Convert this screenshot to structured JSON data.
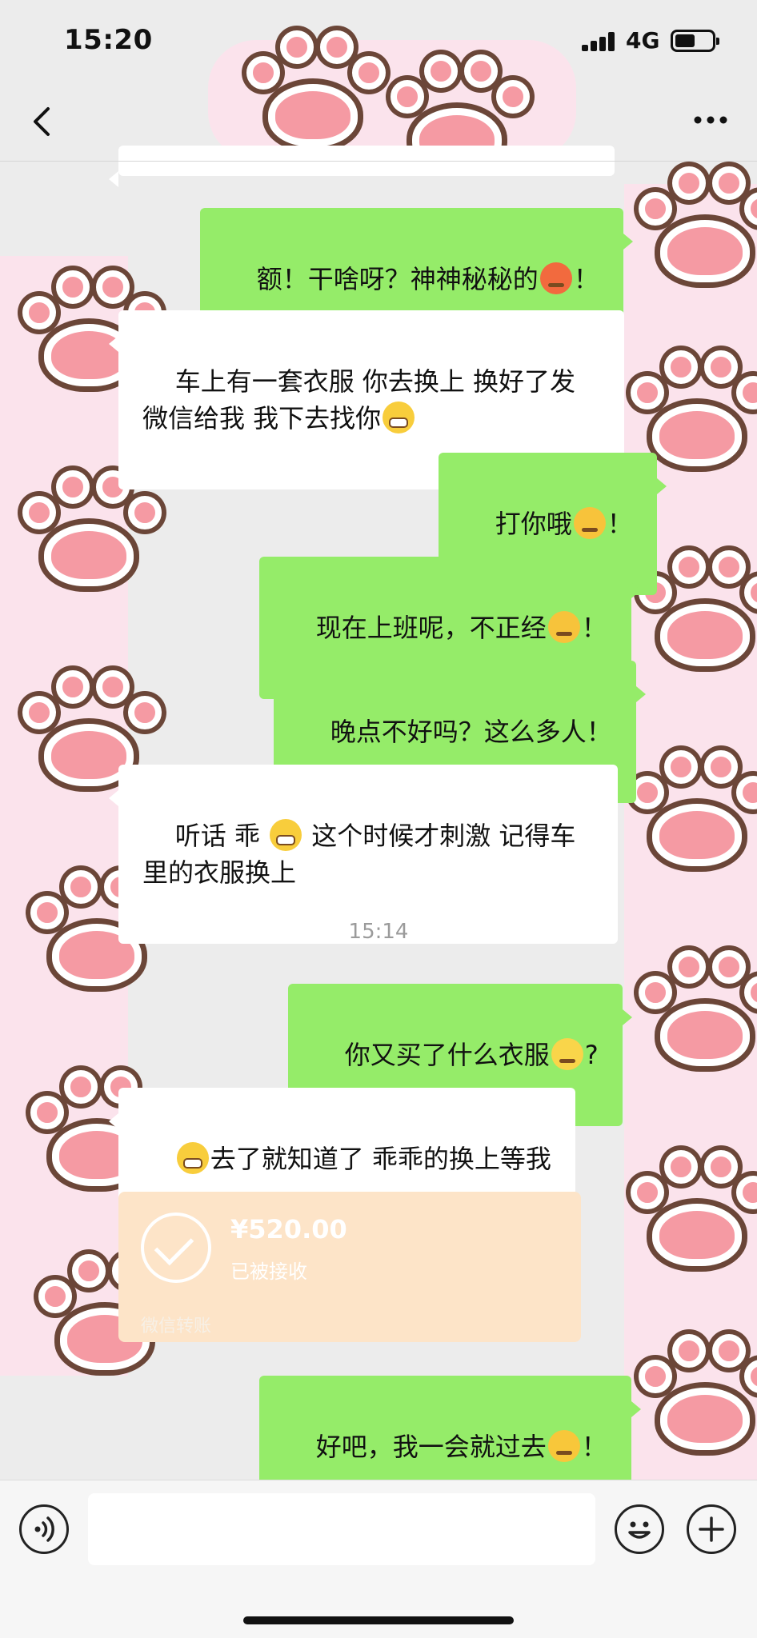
{
  "status_bar": {
    "time": "15:20",
    "network": "4G",
    "battery_level": 0.55
  },
  "nav": {
    "back_icon": "chevron-left-icon",
    "more_icon": "more-dots-icon"
  },
  "messages": [
    {
      "dir": "out",
      "before": "额！干啥呀？神神秘秘的",
      "emoji": "angry-face-icon",
      "after": "！"
    },
    {
      "dir": "in",
      "before": "车上有一套衣服 你去换上 换好了发微信给我 我下去找你",
      "emoji": "grin-face-icon",
      "after": ""
    },
    {
      "dir": "out",
      "before": "打你哦",
      "emoji": "hit-face-icon",
      "after": "！"
    },
    {
      "dir": "out",
      "before": "现在上班呢，不正经",
      "emoji": "hit-face-icon",
      "after": "！"
    },
    {
      "dir": "out",
      "before": "晚点不好吗？这么多人！",
      "emoji": "",
      "after": ""
    },
    {
      "dir": "in",
      "before": "听话 乖 ",
      "emoji": "grin-face-icon",
      "after": " 这个时候才刺激 记得车里的衣服换上"
    },
    {
      "dir": "out",
      "before": "你又买了什么衣服",
      "emoji": "sweat-face-icon",
      "after": "?"
    },
    {
      "dir": "in",
      "before": "",
      "emoji": "grin-face-icon",
      "after": "去了就知道了 乖乖的换上等我"
    },
    {
      "dir": "out",
      "before": "好吧，我一会就过去",
      "emoji": "pleading-face-icon",
      "after": "！"
    }
  ],
  "timestamp": "15:14",
  "transfer": {
    "amount": "¥520.00",
    "status": "已被接收",
    "label": "微信转账"
  },
  "input": {
    "placeholder": ""
  },
  "colors": {
    "outgoing": "#95ec69",
    "incoming": "#ffffff",
    "transfer": "#fde4c8"
  }
}
